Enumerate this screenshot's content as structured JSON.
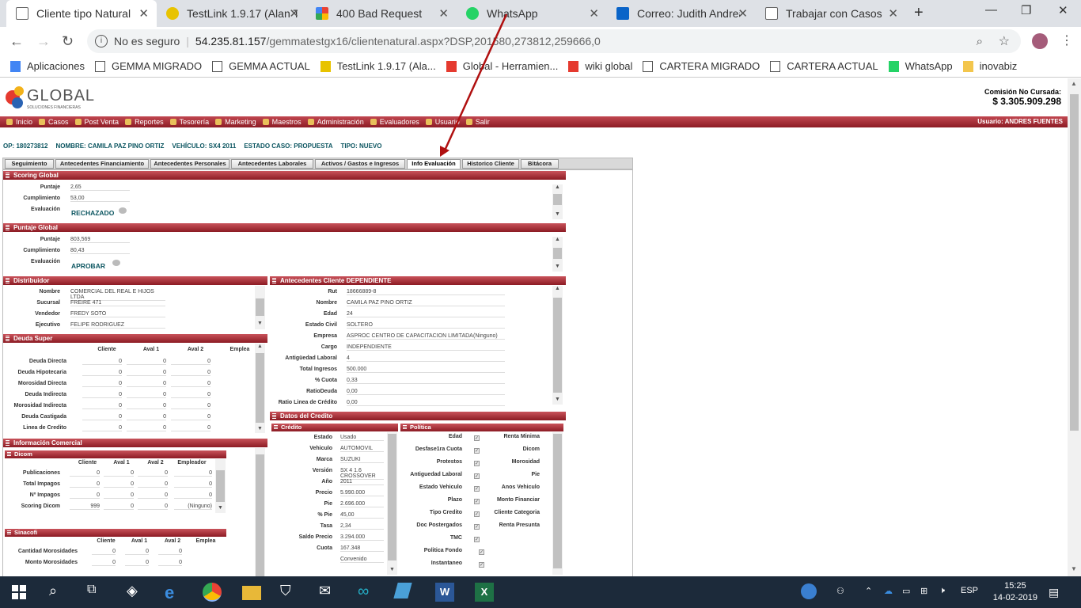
{
  "browser": {
    "tabs": [
      {
        "label": "Cliente tipo Natural",
        "icon": "document-icon",
        "active": true
      },
      {
        "label": "TestLink 1.9.17 (Alan Tu",
        "icon": "testlink-icon"
      },
      {
        "label": "400 Bad Request",
        "icon": "google-icon"
      },
      {
        "label": "WhatsApp",
        "icon": "whatsapp-icon"
      },
      {
        "label": "Correo: Judith Andrea C",
        "icon": "outlook-icon"
      },
      {
        "label": "Trabajar con Casos",
        "icon": "document-icon"
      }
    ],
    "address": {
      "security": "No es seguro",
      "host": "54.235.81.157",
      "path": "/gemmatestgx16/clientenatural.aspx?DSP,201580,273812,259666,0"
    },
    "bookmarks": [
      {
        "label": "Aplicaciones",
        "icon": "apps-icon"
      },
      {
        "label": "GEMMA MIGRADO",
        "icon": "document-icon"
      },
      {
        "label": "GEMMA ACTUAL",
        "icon": "document-icon"
      },
      {
        "label": "TestLink 1.9.17 (Ala...",
        "icon": "testlink-icon"
      },
      {
        "label": "Global - Herramien...",
        "icon": "global-icon"
      },
      {
        "label": "wiki global",
        "icon": "global-icon"
      },
      {
        "label": "CARTERA MIGRADO",
        "icon": "document-icon"
      },
      {
        "label": "CARTERA ACTUAL",
        "icon": "document-icon"
      },
      {
        "label": "WhatsApp",
        "icon": "whatsapp-icon"
      },
      {
        "label": "inovabiz",
        "icon": "folder-icon"
      }
    ]
  },
  "header": {
    "logo_text": "GLOBAL",
    "logo_sub": "SOLUCIONES FINANCIERAS",
    "comision_label": "Comisión No Cursada:",
    "comision_amount": "$ 3.305.909.298"
  },
  "menu": {
    "items": [
      "Inicio",
      "Casos",
      "Post Venta",
      "Reportes",
      "Tesorería",
      "Marketing",
      "Maestros",
      "Administración",
      "Evaluadores",
      "Usuario",
      "Salir"
    ],
    "usuario": "Usuario: ANDRES FUENTES"
  },
  "caseinfo": {
    "op": "OP: 180273812",
    "nombre": "NOMBRE: CAMILA PAZ PINO ORTIZ",
    "vehiculo": "VEHÍCULO: SX4 2011",
    "estado": "ESTADO CASO: PROPUESTA",
    "tipo": "TIPO: NUEVO"
  },
  "pagetabs": [
    "Seguimiento",
    "Antecedentes Financiamiento",
    "Antecedentes Personales",
    "Antecedentes Laborales",
    "Activos / Gastos e Ingresos",
    "Info Evaluación",
    "Historico Cliente",
    "Bitácora"
  ],
  "scoring": {
    "title": "Scoring Global",
    "puntaje_label": "Puntaje",
    "puntaje": "2,65",
    "cumplimiento_label": "Cumplimiento",
    "cumplimiento": "53,00",
    "evaluacion_label": "Evaluación",
    "evaluacion": "RECHAZADO"
  },
  "puntaje_global": {
    "title": "Puntaje Global",
    "puntaje_label": "Puntaje",
    "puntaje": "803,569",
    "cumplimiento_label": "Cumplimiento",
    "cumplimiento": "80,43",
    "evaluacion_label": "Evaluación",
    "evaluacion": "APROBAR"
  },
  "distribuidor": {
    "title": "Distribuidor",
    "rows": [
      {
        "label": "Nombre",
        "value": "COMERCIAL DEL REAL E HIJOS LTDA"
      },
      {
        "label": "Sucursal",
        "value": "FREIRE 471"
      },
      {
        "label": "Vendedor",
        "value": "FREDY SOTO"
      },
      {
        "label": "Ejecutivo",
        "value": "FELIPE RODRIGUEZ"
      }
    ]
  },
  "antecedentes": {
    "title": "Antecedentes Cliente DEPENDIENTE",
    "rows": [
      {
        "label": "Rut",
        "value": "18666889-8"
      },
      {
        "label": "Nombre",
        "value": "CAMILA PAZ PINO ORTIZ"
      },
      {
        "label": "Edad",
        "value": "24"
      },
      {
        "label": "Estado Civil",
        "value": "SOLTERO"
      },
      {
        "label": "Empresa",
        "value": "ASPROC CENTRO DE CAPACITACION LIMITADA",
        "extra": "(Ninguno)"
      },
      {
        "label": "Cargo",
        "value": "INDEPENDIENTE"
      },
      {
        "label": "Antigüedad Laboral",
        "value": "4"
      },
      {
        "label": "Total Ingresos",
        "value": "500.000"
      },
      {
        "label": "% Cuota",
        "value": "0,33"
      },
      {
        "label": "RatioDeuda",
        "value": "0,00"
      },
      {
        "label": "Ratio Linea de Crédito",
        "value": "0,00"
      }
    ]
  },
  "deuda": {
    "title": "Deuda Super",
    "cols": [
      "Cliente",
      "Aval 1",
      "Aval 2",
      "Emplea"
    ],
    "rows": [
      {
        "label": "Deuda Directa",
        "v": [
          "0",
          "0",
          "0"
        ]
      },
      {
        "label": "Deuda Hipotecaria",
        "v": [
          "0",
          "0",
          "0"
        ]
      },
      {
        "label": "Morosidad Directa",
        "v": [
          "0",
          "0",
          "0"
        ]
      },
      {
        "label": "Deuda Indirecta",
        "v": [
          "0",
          "0",
          "0"
        ]
      },
      {
        "label": "Morosidad Indirecta",
        "v": [
          "0",
          "0",
          "0"
        ]
      },
      {
        "label": "Deuda Castigada",
        "v": [
          "0",
          "0",
          "0"
        ]
      },
      {
        "label": "Linea de Credito",
        "v": [
          "0",
          "0",
          "0"
        ]
      }
    ]
  },
  "infocomercial": {
    "title": "Información Comercial",
    "dicom": {
      "title": "Dicom",
      "cols": [
        "Cliente",
        "Aval 1",
        "Aval 2",
        "Empleador"
      ],
      "rows": [
        {
          "label": "Publicaciones",
          "v": [
            "0",
            "0",
            "0",
            "0"
          ]
        },
        {
          "label": "Total Impagos",
          "v": [
            "0",
            "0",
            "0",
            "0"
          ]
        },
        {
          "label": "Nº Impagos",
          "v": [
            "0",
            "0",
            "0",
            "0"
          ]
        },
        {
          "label": "Scoring Dicom",
          "v": [
            "999",
            "0",
            "0",
            "(Ninguno)"
          ]
        }
      ]
    },
    "sinacofi": {
      "title": "Sinacofi",
      "cols": [
        "Cliente",
        "Aval 1",
        "Aval 2",
        "Emplea"
      ],
      "rows": [
        {
          "label": "Cantidad Morosidades",
          "v": [
            "0",
            "0",
            "0"
          ]
        },
        {
          "label": "Monto Morosidades",
          "v": [
            "0",
            "0",
            "0"
          ]
        }
      ]
    }
  },
  "datoscredito": {
    "title": "Datos del Credito",
    "credito": {
      "title": "Crédito",
      "rows": [
        {
          "label": "Estado",
          "value": "Usado"
        },
        {
          "label": "Vehiculo",
          "value": "AUTOMOVIL"
        },
        {
          "label": "Marca",
          "value": "SUZUKI"
        },
        {
          "label": "Versión",
          "value": "SX 4 1.6 CROSSOVER"
        },
        {
          "label": "Año",
          "value": "2011"
        },
        {
          "label": "Precio",
          "value": "5.990.000"
        },
        {
          "label": "Pie",
          "value": "2.696.000"
        },
        {
          "label": "% Pie",
          "value": "45,00"
        },
        {
          "label": "Tasa",
          "value": "2,34"
        },
        {
          "label": "Saldo Precio",
          "value": "3.294.000"
        },
        {
          "label": "Cuota",
          "value": "167.348"
        },
        {
          "label": "",
          "value": "Convenido"
        }
      ]
    },
    "politica": {
      "title": "Política",
      "left": [
        "Edad",
        "Desfase1ra Cuota",
        "Protestos",
        "Antiguedad Laboral",
        "Estado Vehiculo",
        "Plazo",
        "Tipo Credito",
        "Doc Postergados",
        "TMC",
        "Politica Fondo",
        "Instantaneo"
      ],
      "right": [
        "Renta Minima",
        "Dicom",
        "Morosidad",
        "Pie",
        "Anos Vehiculo",
        "Monto Financiar",
        "Cliente Categoria",
        "Renta Presunta"
      ]
    }
  },
  "taskbar": {
    "lang": "ESP",
    "time": "15:25",
    "date": "14-02-2019"
  }
}
